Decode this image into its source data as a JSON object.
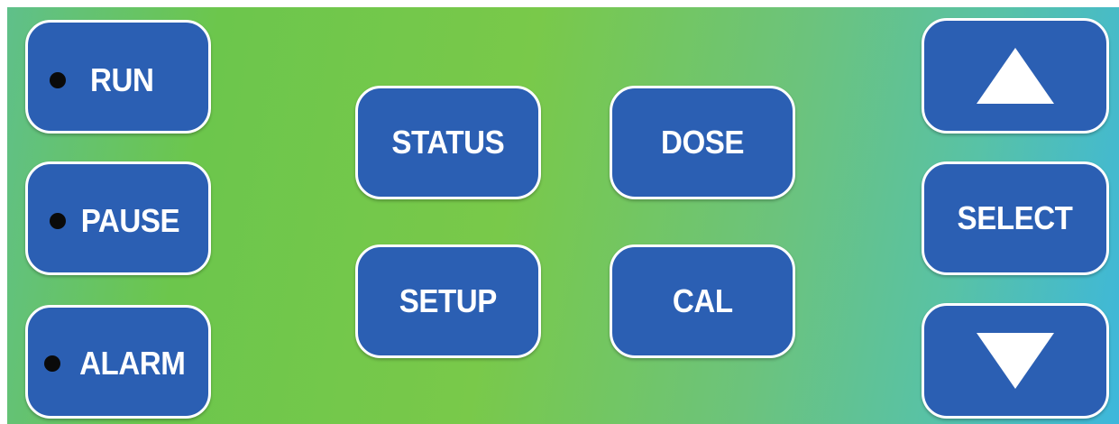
{
  "status_keys": {
    "run": {
      "label": "RUN"
    },
    "pause": {
      "label": "PAUSE"
    },
    "alarm": {
      "label": "ALARM"
    }
  },
  "function_keys": {
    "status": "STATUS",
    "dose": "DOSE",
    "setup": "SETUP",
    "cal": "CAL"
  },
  "nav_keys": {
    "up_icon": "triangle-up",
    "select": "SELECT",
    "down_icon": "triangle-down"
  },
  "colors": {
    "button": "#2b5fb3",
    "led": "#0a0a0a",
    "gradient_left": "#6cc64c",
    "gradient_right": "#3db7dc"
  }
}
